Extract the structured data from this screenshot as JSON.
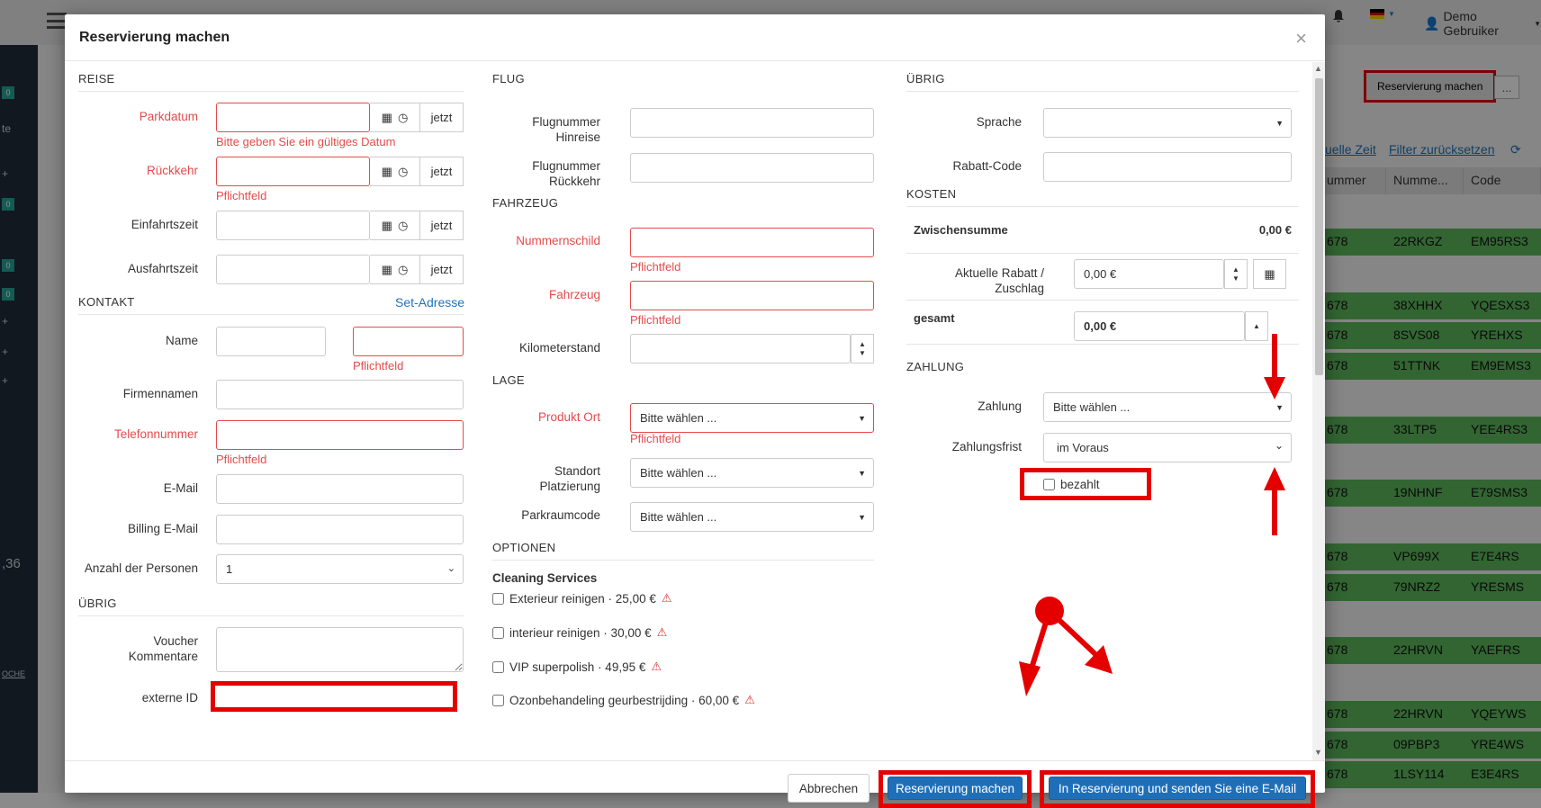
{
  "background": {
    "top_right": {
      "flag": "de-flag-icon",
      "user": "Demo Gebruiker"
    },
    "reserve_button": "Reservierung machen",
    "more_button": "...",
    "filter_links": [
      "uelle Zeit",
      "Filter zurücksetzen"
    ],
    "table_headers": [
      "ummer",
      "Numme...",
      "Code"
    ],
    "rows": [
      {
        "a": "678",
        "b": "22RKGZ",
        "c": "EM95RS3"
      },
      {
        "a": "678",
        "b": "38XHHX",
        "c": "YQESXS3"
      },
      {
        "a": "678",
        "b": "8SVS08",
        "c": "YREHXS"
      },
      {
        "a": "678",
        "b": "51TTNK",
        "c": "EM9EMS3"
      },
      {
        "a": "678",
        "b": "33LTP5",
        "c": "YEE4RS3"
      },
      {
        "a": "678",
        "b": "19NHNF",
        "c": "E79SMS3"
      },
      {
        "a": "678",
        "b": "VP699X",
        "c": "E7E4RS"
      },
      {
        "a": "678",
        "b": "79NRZ2",
        "c": "YRESMS"
      },
      {
        "a": "678",
        "b": "22HRVN",
        "c": "YAEFRS"
      },
      {
        "a": "678",
        "b": "22HRVN",
        "c": "YQEYWS"
      },
      {
        "a": "678",
        "b": "09PBP3",
        "c": "YRE4WS"
      },
      {
        "a": "678",
        "b": "1LSY114",
        "c": "E3E4RS"
      }
    ],
    "sidebar_value": ",36",
    "sidebar_link": "OCHE",
    "sidebar_text_te": "te",
    "badge": "0"
  },
  "modal": {
    "title": "Reservierung machen",
    "close": "×",
    "reise": {
      "section": "REISE",
      "parkdatum": "Parkdatum",
      "rueckkehr": "Rückkehr",
      "einfahrtszeit": "Einfahrtszeit",
      "ausfahrtszeit": "Ausfahrtszeit",
      "now": "jetzt",
      "date_error": "Bitte geben Sie ein gültiges Datum",
      "required": "Pflichtfeld"
    },
    "kontakt": {
      "section": "KONTAKT",
      "set_address": "Set-Adresse",
      "name": "Name",
      "firma": "Firmennamen",
      "telefon": "Telefonnummer",
      "email": "E-Mail",
      "billing_email": "Billing E-Mail",
      "personen": "Anzahl der Personen",
      "personen_value": "1"
    },
    "uebrig_left": {
      "section": "ÜBRIG",
      "voucher": "Voucher Kommentare",
      "externe": "externe ID"
    },
    "flug": {
      "section": "FLUG",
      "hin": "Flugnummer Hinreise",
      "rueck": "Flugnummer Rückkehr"
    },
    "fahrzeug": {
      "section": "FAHRZEUG",
      "kennzeichen": "Nummernschild",
      "fahrzeug": "Fahrzeug",
      "km": "Kilometerstand"
    },
    "lage": {
      "section": "LAGE",
      "produkt": "Produkt Ort",
      "standort": "Standort Platzierung",
      "parkraum": "Parkraumcode",
      "placeholder": "Bitte wählen ..."
    },
    "optionen": {
      "section": "OPTIONEN",
      "group": "Cleaning Services",
      "items": [
        "Exterieur reinigen · 25,00 €",
        "interieur reinigen · 30,00 €",
        "VIP superpolish · 49,95 €",
        "Ozonbehandeling geurbestrijding · 60,00 €"
      ]
    },
    "uebrig_right": {
      "section": "ÜBRIG",
      "sprache": "Sprache",
      "rabatt_code": "Rabatt-Code"
    },
    "kosten": {
      "section": "KOSTEN",
      "zwischensumme": "Zwischensumme",
      "zwischensumme_value": "0,00 €",
      "rabatt": "Aktuelle Rabatt / Zuschlag",
      "rabatt_value": "0,00 €",
      "gesamt": "gesamt",
      "gesamt_value": "0,00 €"
    },
    "zahlung": {
      "section": "ZAHLUNG",
      "zahlung": "Zahlung",
      "zahlung_value": "Bitte wählen ...",
      "frist": "Zahlungsfrist",
      "frist_value": "im Voraus",
      "bezahlt": "bezahlt"
    },
    "footer": {
      "cancel": "Abbrechen",
      "save": "Reservierung machen",
      "save_email": "In Reservierung und senden Sie eine E-Mail"
    }
  },
  "colors": {
    "error": "#e54b4b",
    "primary": "#1f6fb8",
    "annotation": "#e50000",
    "row_green": "#5cb85c"
  }
}
